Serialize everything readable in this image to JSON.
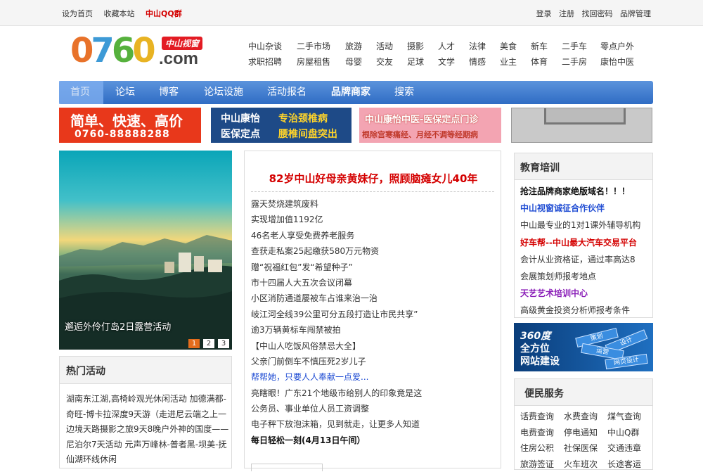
{
  "topbar": {
    "left": [
      "设为首页",
      "收藏本站"
    ],
    "qq": "中山QQ群",
    "right": [
      "登录",
      "注册",
      "找回密码",
      "品牌管理"
    ]
  },
  "logo": {
    "digits": "0760",
    "domain": ".com",
    "badge": "中山视窗"
  },
  "categories": {
    "row1": [
      "中山杂谈",
      "二手市场",
      "旅游",
      "活动",
      "摄影",
      "人才",
      "法律",
      "美食",
      "新车",
      "二手车",
      "零点户外"
    ],
    "row2": [
      "求职招聘",
      "房屋租售",
      "母婴",
      "交友",
      "足球",
      "文学",
      "情感",
      "业主",
      "体育",
      "二手房",
      "康怡中医"
    ]
  },
  "nav": [
    "首页",
    "论坛",
    "博客",
    "论坛设施",
    "活动报名",
    "品牌商家",
    "搜索"
  ],
  "ads": {
    "ad1": {
      "line1": "简单、快速、高价",
      "line2": "0760-88888288"
    },
    "ad2": {
      "l1": "中山康怡",
      "l2": "医保定点",
      "r1": "专治颈椎病",
      "r2": "腰椎间盘突出"
    },
    "ad3": {
      "line1": "中山康怡中医-医保定点门诊",
      "line2": "根除宫寒痛经、月经不调等经期病"
    }
  },
  "slide": {
    "caption": "邂逅外伶仃岛2日露营活动",
    "pages": [
      "1",
      "2",
      "3"
    ]
  },
  "hot": {
    "title": "热门活动",
    "text": "湖南东江湖,高椅岭观光休闲活动 加德满都-奇旺-博卡拉深度9天游（走进尼云端之上一边境天路摄影之旅9天8晚户外神的国度——尼泊尔7天活动 元声万峰林-普者黑-坝美-抚仙湖环线休闲"
  },
  "news": {
    "headline": "82岁中山好母亲黄妹仔，照顾脑瘫女儿40年",
    "items": [
      {
        "text": "露天焚烧建筑废料",
        "style": ""
      },
      {
        "text": "实现增加值1192亿",
        "style": ""
      },
      {
        "text": "46名老人享受免费养老服务",
        "style": ""
      },
      {
        "text": "查获走私案25起缴获580万元物资",
        "style": ""
      },
      {
        "text": "赠“祝福红包”发“希望种子”",
        "style": ""
      },
      {
        "text": "市十四届人大五次会议闭幕",
        "style": ""
      },
      {
        "text": "小区消防通道屡被车占谁来治一治",
        "style": ""
      },
      {
        "text": "岐江河全线39公里可分五段打造让市民共享”",
        "style": ""
      },
      {
        "text": "逾3万辆黄标车闯禁被拍",
        "style": ""
      },
      {
        "text": "【中山人吃饭风俗禁忌大全】",
        "style": ""
      },
      {
        "text": "父亲门前倒车不慎压死2岁儿子",
        "style": ""
      },
      {
        "text": "帮帮她，只要人人奉献一点爱...",
        "style": "blue"
      },
      {
        "text": "亮瞎眼！广东21个地级市给别人的印象竟是这",
        "style": ""
      },
      {
        "text": "公务员、事业单位人员工资调整",
        "style": ""
      },
      {
        "text": "电子秤下放泡沫箱，见到就走，让更多人知道",
        "style": ""
      },
      {
        "text": "每日轻松一刻(4月13日午间）",
        "style": "bold"
      }
    ]
  },
  "edu": {
    "title": "教育培训",
    "items": [
      {
        "text": "抢注品牌商家绝版域名！！！",
        "color": "#111111",
        "bold": true
      },
      {
        "text": "中山视窗诚征合作伙伴",
        "color": "#1f4cd3",
        "bold": true
      },
      {
        "text": "中山最专业的1对1课外辅导机构",
        "color": "#333333",
        "bold": false
      },
      {
        "text": "好车帮--中山最大汽车交易平台",
        "color": "#d40000",
        "bold": true
      },
      {
        "text": "会计从业资格证，通过率高达8",
        "color": "#333333",
        "bold": false
      },
      {
        "text": "会展策划师报考地点",
        "color": "#333333",
        "bold": false
      },
      {
        "text": "天艺艺术培训中心",
        "color": "#8a1fb8",
        "bold": true
      },
      {
        "text": "高级黄金投资分析师报考条件",
        "color": "#333333",
        "bold": false
      }
    ]
  },
  "ban360": {
    "t1": "360度",
    "t2": "全方位",
    "t3": "网站建设",
    "signs": [
      "策划",
      "设计",
      "运营",
      "网页设计"
    ]
  },
  "svc": {
    "title": "便民服务",
    "items": [
      "话费查询",
      "水费查询",
      "煤气查询",
      "电费查询",
      "停电通知",
      "中山Q群",
      "住房公积",
      "社保医保",
      "交通违章",
      "旅游签证",
      "火车班次",
      "长途客运"
    ]
  },
  "colors": {
    "brand_red": "#d40000",
    "nav_blue": "#2f6cc4",
    "link_blue": "#1f4cd3"
  }
}
